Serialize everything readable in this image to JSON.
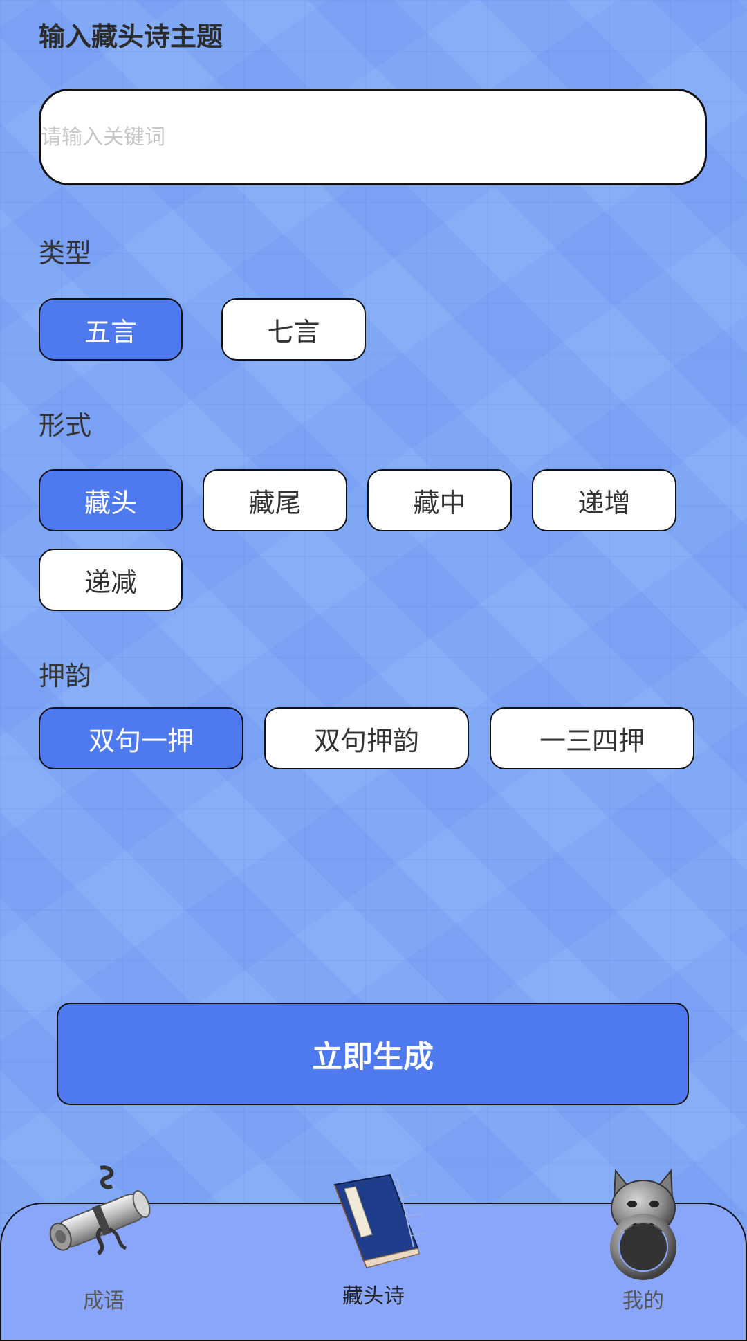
{
  "form": {
    "title": "输入藏头诗主题",
    "keyword_placeholder": "请输入关键词",
    "keyword_value": ""
  },
  "type_section": {
    "label": "类型",
    "options": [
      "五言",
      "七言"
    ],
    "selected": "五言"
  },
  "form_section": {
    "label": "形式",
    "options": [
      "藏头",
      "藏尾",
      "藏中",
      "递增",
      "递减"
    ],
    "selected": "藏头"
  },
  "rhyme_section": {
    "label": "押韵",
    "options": [
      "双句一押",
      "双句押韵",
      "一三四押"
    ],
    "selected": "双句一押"
  },
  "generate_label": "立即生成",
  "tabbar": {
    "tabs": [
      {
        "label": "成语",
        "icon": "scroll-icon"
      },
      {
        "label": "藏头诗",
        "icon": "book-icon"
      },
      {
        "label": "我的",
        "icon": "door-knocker-icon"
      }
    ],
    "active": "藏头诗"
  },
  "colors": {
    "accent": "#4f79ee",
    "background": "#7fa8f6",
    "tabbar": "#8aa6fb"
  }
}
